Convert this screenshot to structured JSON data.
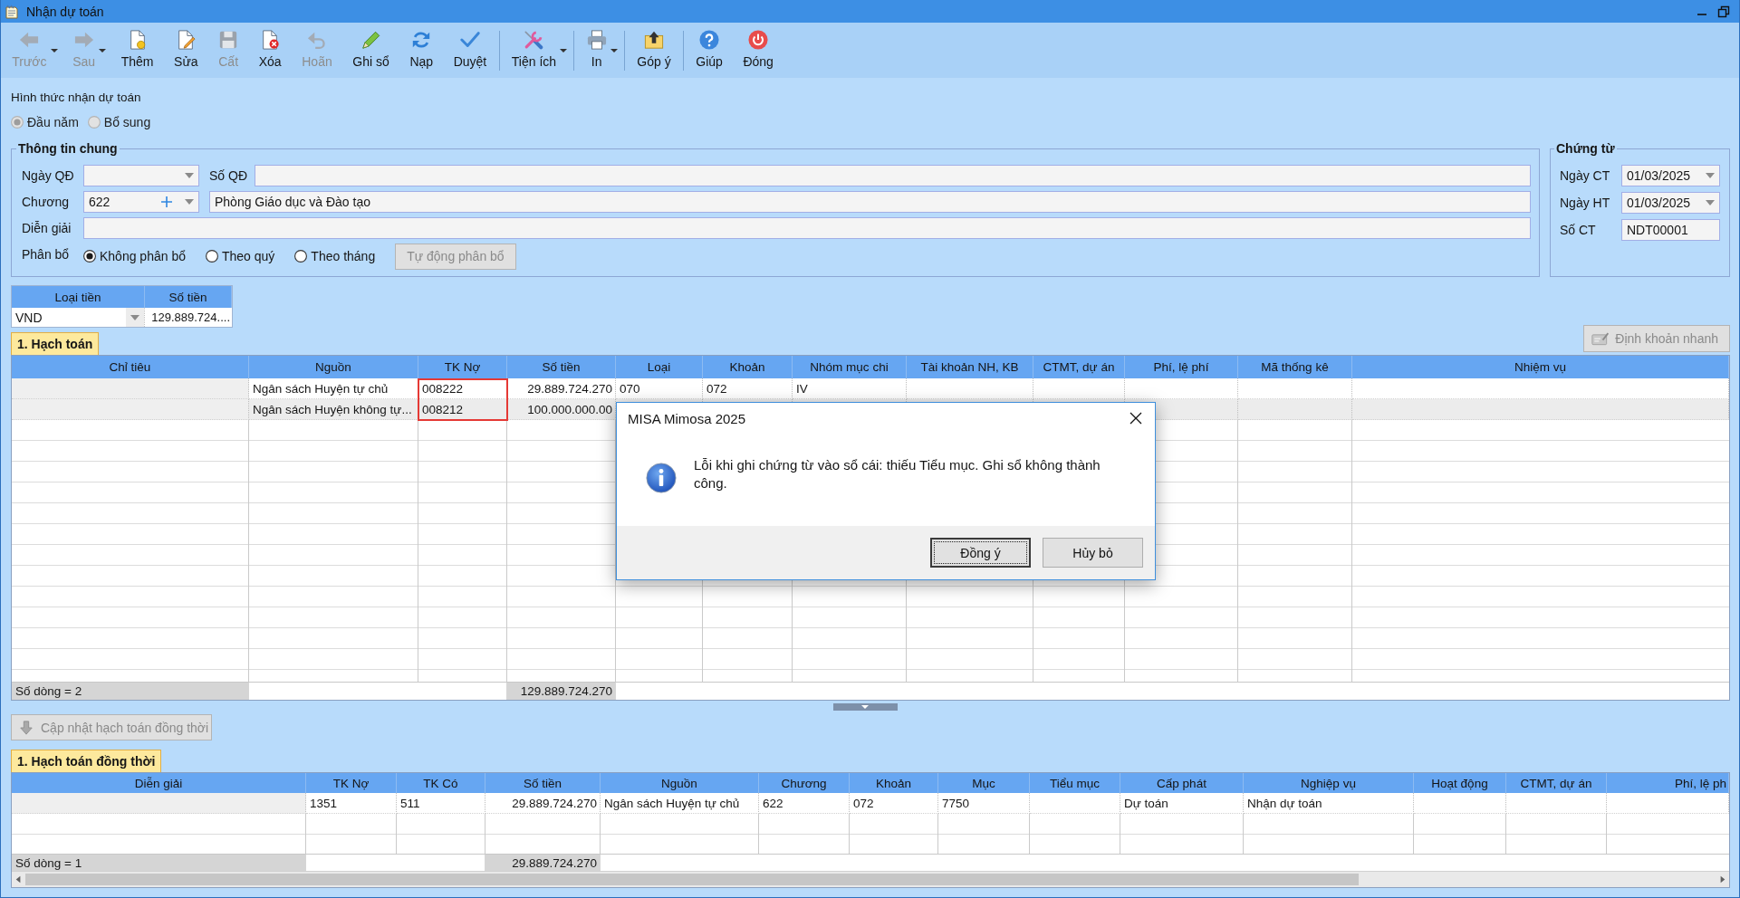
{
  "window": {
    "title": "Nhận dự toán"
  },
  "toolbar": [
    {
      "label": "Trước",
      "disabled": true,
      "dropdown": true,
      "separator_before": false
    },
    {
      "label": "Sau",
      "disabled": true,
      "dropdown": true,
      "separator_before": false
    },
    {
      "label": "Thêm",
      "disabled": false,
      "dropdown": false,
      "separator_before": false
    },
    {
      "label": "Sửa",
      "disabled": false,
      "dropdown": false,
      "separator_before": false
    },
    {
      "label": "Cất",
      "disabled": true,
      "dropdown": false,
      "separator_before": false
    },
    {
      "label": "Xóa",
      "disabled": false,
      "dropdown": false,
      "separator_before": false
    },
    {
      "label": "Hoãn",
      "disabled": true,
      "dropdown": false,
      "separator_before": false
    },
    {
      "label": "Ghi sổ",
      "disabled": false,
      "dropdown": false,
      "separator_before": false
    },
    {
      "label": "Nạp",
      "disabled": false,
      "dropdown": false,
      "separator_before": false
    },
    {
      "label": "Duyệt",
      "disabled": false,
      "dropdown": false,
      "separator_before": false
    },
    {
      "label": "Tiện ích",
      "disabled": false,
      "dropdown": true,
      "separator_before": true
    },
    {
      "label": "In",
      "disabled": false,
      "dropdown": true,
      "separator_before": true
    },
    {
      "label": "Góp ý",
      "disabled": false,
      "dropdown": false,
      "separator_before": true
    },
    {
      "label": "Giúp",
      "disabled": false,
      "dropdown": false,
      "separator_before": true
    },
    {
      "label": "Đóng",
      "disabled": false,
      "dropdown": false,
      "separator_before": false
    }
  ],
  "receive_type": {
    "label": "Hình thức nhận dự toán",
    "disabled": true,
    "options": [
      {
        "label": "Đầu năm",
        "selected": true
      },
      {
        "label": "Bổ sung",
        "selected": false
      }
    ]
  },
  "general": {
    "title": "Thông tin chung",
    "decision_date": {
      "label": "Ngày QĐ"
    },
    "decision_number": {
      "label": "Số QĐ"
    },
    "chapter": {
      "label": "Chương",
      "value": "622",
      "name": "Phòng Giáo dục và Đào tạo"
    },
    "description": {
      "label": "Diễn giải"
    },
    "allocation": {
      "label": "Phân bổ",
      "options": [
        {
          "label": "Không phân bổ",
          "selected": true
        },
        {
          "label": "Theo quý",
          "selected": false
        },
        {
          "label": "Theo tháng",
          "selected": false
        }
      ],
      "button": {
        "label": "Tự động phân bổ",
        "disabled": true
      }
    }
  },
  "voucher": {
    "title": "Chứng từ",
    "fields": [
      {
        "label": "Ngày CT",
        "value": "01/03/2025",
        "kind": "date"
      },
      {
        "label": "Ngày HT",
        "value": "01/03/2025",
        "kind": "date"
      },
      {
        "label": "Số CT",
        "value": "NDT00001",
        "kind": "text"
      }
    ]
  },
  "currency": {
    "columns": [
      "Loại tiền",
      "Số tiền"
    ],
    "currency": "VND",
    "amount": "129.889.724...."
  },
  "posting": {
    "tabs": [
      {
        "label": "1. Hạch toán",
        "selected": true
      }
    ],
    "quick_button": {
      "label": "Định khoản nhanh",
      "disabled": true
    },
    "columns": [
      {
        "label": "Chỉ tiêu",
        "kind": "readonly",
        "marked": false
      },
      {
        "label": "Nguồn",
        "kind": "text",
        "marked": false
      },
      {
        "label": "TK Nợ",
        "kind": "text",
        "marked": true
      },
      {
        "label": "Số tiền",
        "kind": "amount",
        "marked": false
      },
      {
        "label": "Loại",
        "kind": "text",
        "marked": false
      },
      {
        "label": "Khoản",
        "kind": "text",
        "marked": false
      },
      {
        "label": "Nhóm mục chi",
        "kind": "text",
        "marked": false
      },
      {
        "label": "Tài khoản NH, KB",
        "kind": "text",
        "marked": false
      },
      {
        "label": "CTMT, dự án",
        "kind": "text",
        "marked": false
      },
      {
        "label": "Phí, lệ phí",
        "kind": "text",
        "marked": false
      },
      {
        "label": "Mã thống kê",
        "kind": "text",
        "marked": false
      },
      {
        "label": "Nhiệm vụ",
        "kind": "text",
        "marked": false
      }
    ],
    "rows": [
      {
        "selected": false,
        "cells": [
          null,
          "Ngân sách Huyện tự chủ",
          "008222",
          "29.889.724.270",
          "070",
          "072",
          "IV"
        ]
      },
      {
        "selected": true,
        "cells": [
          null,
          "Ngân sách Huyện không tự...",
          "008212",
          "100.000.000.00"
        ]
      }
    ],
    "footer": {
      "count": "Số dòng = 2",
      "total": "129.889.724.270"
    }
  },
  "update_button": {
    "label": "Cập nhật hạch toán đồng thời",
    "disabled": true
  },
  "simultaneous": {
    "tabs": [
      {
        "label": "1. Hạch toán đồng thời",
        "selected": true
      }
    ],
    "columns": [
      {
        "label": "Diễn giải",
        "kind": "readonly"
      },
      {
        "label": "TK Nợ",
        "kind": "text"
      },
      {
        "label": "TK Có",
        "kind": "text"
      },
      {
        "label": "Số tiền",
        "kind": "amount"
      },
      {
        "label": "Nguồn",
        "kind": "text"
      },
      {
        "label": "Chương",
        "kind": "text"
      },
      {
        "label": "Khoản",
        "kind": "text"
      },
      {
        "label": "Mục",
        "kind": "text"
      },
      {
        "label": "Tiểu mục",
        "kind": "text"
      },
      {
        "label": "Cấp phát",
        "kind": "text"
      },
      {
        "label": "Nghiệp vụ",
        "kind": "text"
      },
      {
        "label": "Hoạt động",
        "kind": "text"
      },
      {
        "label": "CTMT, dự án",
        "kind": "text"
      },
      {
        "label": "Phí, lệ ph",
        "kind": "text"
      }
    ],
    "rows": [
      {
        "cells": [
          null,
          "1351",
          "511",
          "29.889.724.270",
          "Ngân sách Huyện tự chủ",
          "622",
          "072",
          "7750",
          null,
          "Dự toán",
          "Nhận dự toán"
        ]
      }
    ],
    "footer": {
      "count": "Số dòng = 1",
      "total": "29.889.724.270"
    }
  },
  "dialog": {
    "title": "MISA Mimosa 2025",
    "message": "Lỗi khi ghi chứng từ vào sổ cái: thiếu Tiểu mục. Ghi sổ không thành công.",
    "buttons": [
      {
        "label": "Đồng ý",
        "default": true
      },
      {
        "label": "Hủy bỏ",
        "default": false
      }
    ]
  }
}
